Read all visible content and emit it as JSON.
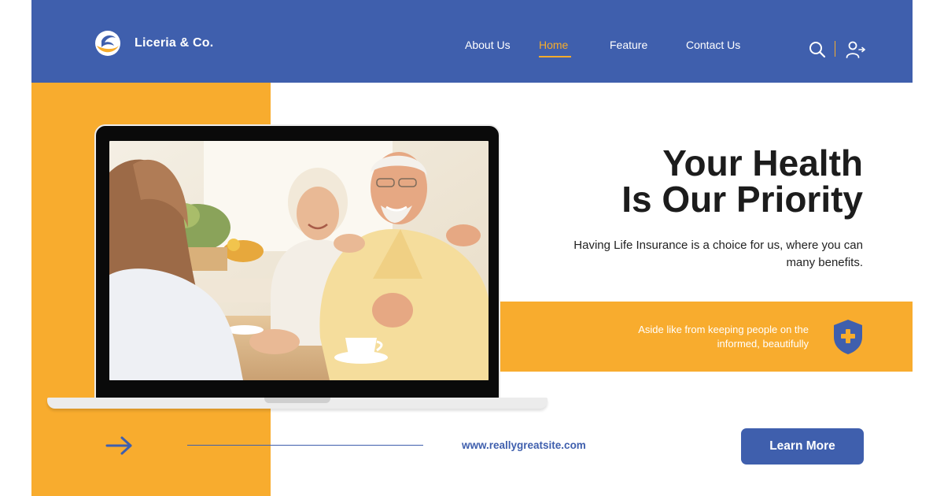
{
  "header": {
    "brand": "Liceria & Co.",
    "logo_icon": "wing-swoosh-logo",
    "nav": [
      {
        "label": "About Us",
        "active": false
      },
      {
        "label": "Home",
        "active": true
      },
      {
        "label": "Feature",
        "active": false
      },
      {
        "label": "Contact Us",
        "active": false
      }
    ],
    "icons": [
      "search-icon",
      "user-login-icon"
    ]
  },
  "hero": {
    "title_line1": "Your Health",
    "title_line2": "Is Our Priority",
    "subtitle": "Having Life Insurance is a choice for us, where you can many benefits.",
    "image": "elderly-couple-consultation-photo"
  },
  "info_band": {
    "text": "Aside like from keeping people on the informed, beautifully",
    "icon": "shield-plus-icon"
  },
  "footer": {
    "arrow_icon": "arrow-right-icon",
    "url": "www.reallygreatsite.com",
    "cta_label": "Learn More"
  },
  "colors": {
    "primary_blue": "#3f5fad",
    "accent_orange": "#f8ac2e",
    "text_dark": "#1c1c1c",
    "white": "#ffffff"
  }
}
